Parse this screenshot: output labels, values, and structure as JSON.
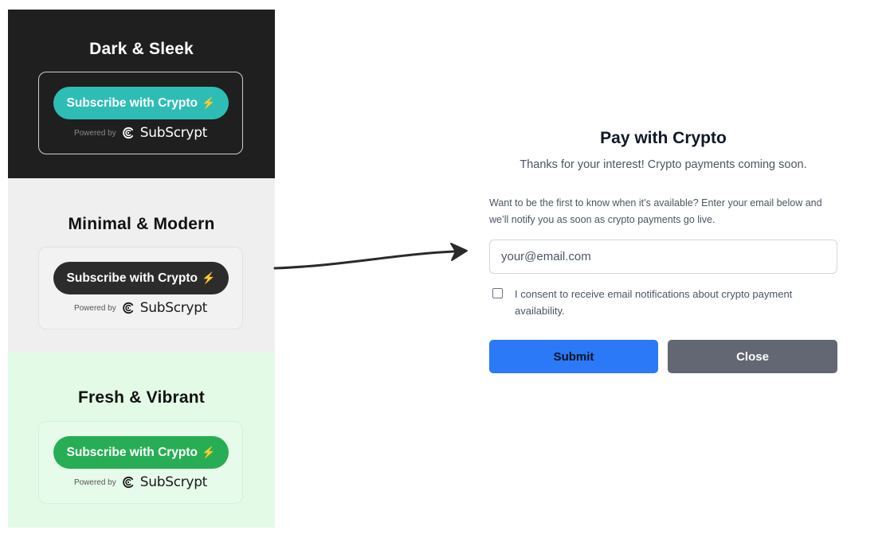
{
  "themes": [
    {
      "title": "Dark & Sleek",
      "button_label": "Subscribe with Crypto",
      "button_icon": "⚡",
      "powered_by": "Powered by",
      "brand": "SubScrypt",
      "colors": {
        "background": "#1f1f1f",
        "button": "#2ebdb5"
      }
    },
    {
      "title": "Minimal & Modern",
      "button_label": "Subscribe with Crypto",
      "button_icon": "⚡",
      "powered_by": "Powered by",
      "brand": "SubScrypt",
      "colors": {
        "background": "#efefef",
        "button": "#2c2c2c"
      }
    },
    {
      "title": "Fresh & Vibrant",
      "button_label": "Subscribe with Crypto",
      "button_icon": "⚡",
      "powered_by": "Powered by",
      "brand": "SubScrypt",
      "colors": {
        "background": "#e3fbe6",
        "button": "#27ae55"
      }
    }
  ],
  "modal": {
    "title": "Pay with Crypto",
    "subtitle": "Thanks for your interest! Crypto payments coming soon.",
    "description": "Want to be the first to know when it’s available? Enter your email below and we’ll notify you as soon as crypto payments go live.",
    "email_placeholder": "your@email.com",
    "email_value": "",
    "consent_checked": false,
    "consent_label": "I consent to receive email notifications about crypto payment availability.",
    "submit_label": "Submit",
    "close_label": "Close",
    "colors": {
      "submit": "#2b79f6",
      "close": "#636673"
    }
  }
}
